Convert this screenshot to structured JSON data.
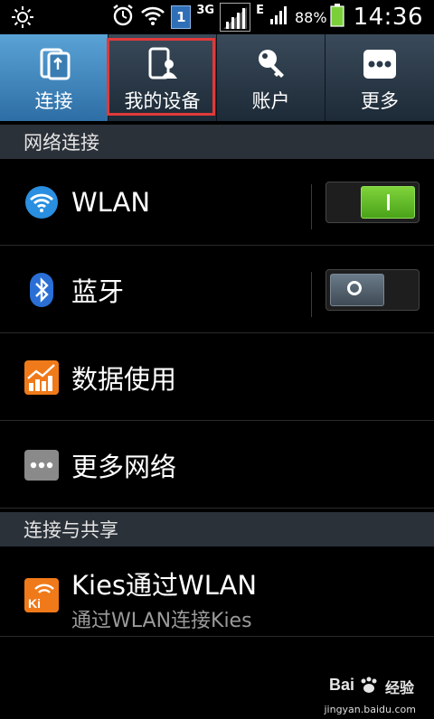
{
  "status_bar": {
    "network_type": "3G",
    "data_type": "E",
    "sim_badge": "1",
    "battery_percent": "88%",
    "time": "14:36"
  },
  "tabs": [
    {
      "label": "连接",
      "icon": "connect-icon",
      "active": true
    },
    {
      "label": "我的设备",
      "icon": "my-device-icon",
      "active": false
    },
    {
      "label": "账户",
      "icon": "key-icon",
      "active": false
    },
    {
      "label": "更多",
      "icon": "more-icon",
      "active": false
    }
  ],
  "sections": {
    "network": "网络连接",
    "share": "连接与共享"
  },
  "rows": {
    "wlan": {
      "label": "WLAN",
      "icon": "wifi-icon",
      "toggle": "on"
    },
    "bluetooth": {
      "label": "蓝牙",
      "icon": "bluetooth-icon",
      "toggle": "off"
    },
    "data_usage": {
      "label": "数据使用",
      "icon": "data-usage-icon"
    },
    "more_networks": {
      "label": "更多网络",
      "icon": "more-networks-icon"
    },
    "kies": {
      "label": "Kies通过WLAN",
      "sub": "通过WLAN连接Kies",
      "icon": "kies-icon"
    }
  },
  "watermark": {
    "brand": "经验",
    "url": "jingyan.baidu.com"
  },
  "colors": {
    "tab_active": "#3f8ac0",
    "highlight_box": "#e03a3a",
    "toggle_on": "#6cc52e",
    "section_bg": "#2b3139"
  }
}
